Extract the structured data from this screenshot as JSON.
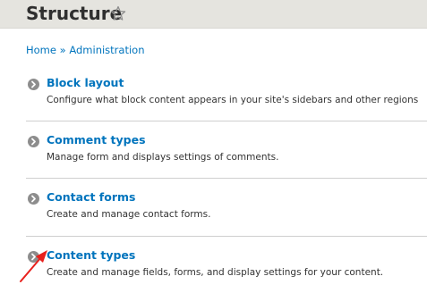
{
  "header": {
    "title": "Structure",
    "shortcut_icon": "star-outline-icon"
  },
  "breadcrumb": {
    "home": "Home",
    "separator": "»",
    "current": "Administration"
  },
  "items": [
    {
      "title": "Block layout",
      "description": "Configure what block content appears in your site's sidebars and other regions",
      "icon": "chevron-right-circle-icon"
    },
    {
      "title": "Comment types",
      "description": "Manage form and displays settings of comments.",
      "icon": "chevron-right-circle-icon"
    },
    {
      "title": "Contact forms",
      "description": "Create and manage contact forms.",
      "icon": "chevron-right-circle-icon"
    },
    {
      "title": "Content types",
      "description": "Create and manage fields, forms, and display settings for your content.",
      "icon": "chevron-right-circle-icon"
    }
  ],
  "annotation": {
    "icon": "red-arrow-pointer-icon",
    "color": "#e8201c"
  },
  "colors": {
    "link": "#0074bd",
    "header_bg": "#e5e4df",
    "text": "#333333"
  }
}
